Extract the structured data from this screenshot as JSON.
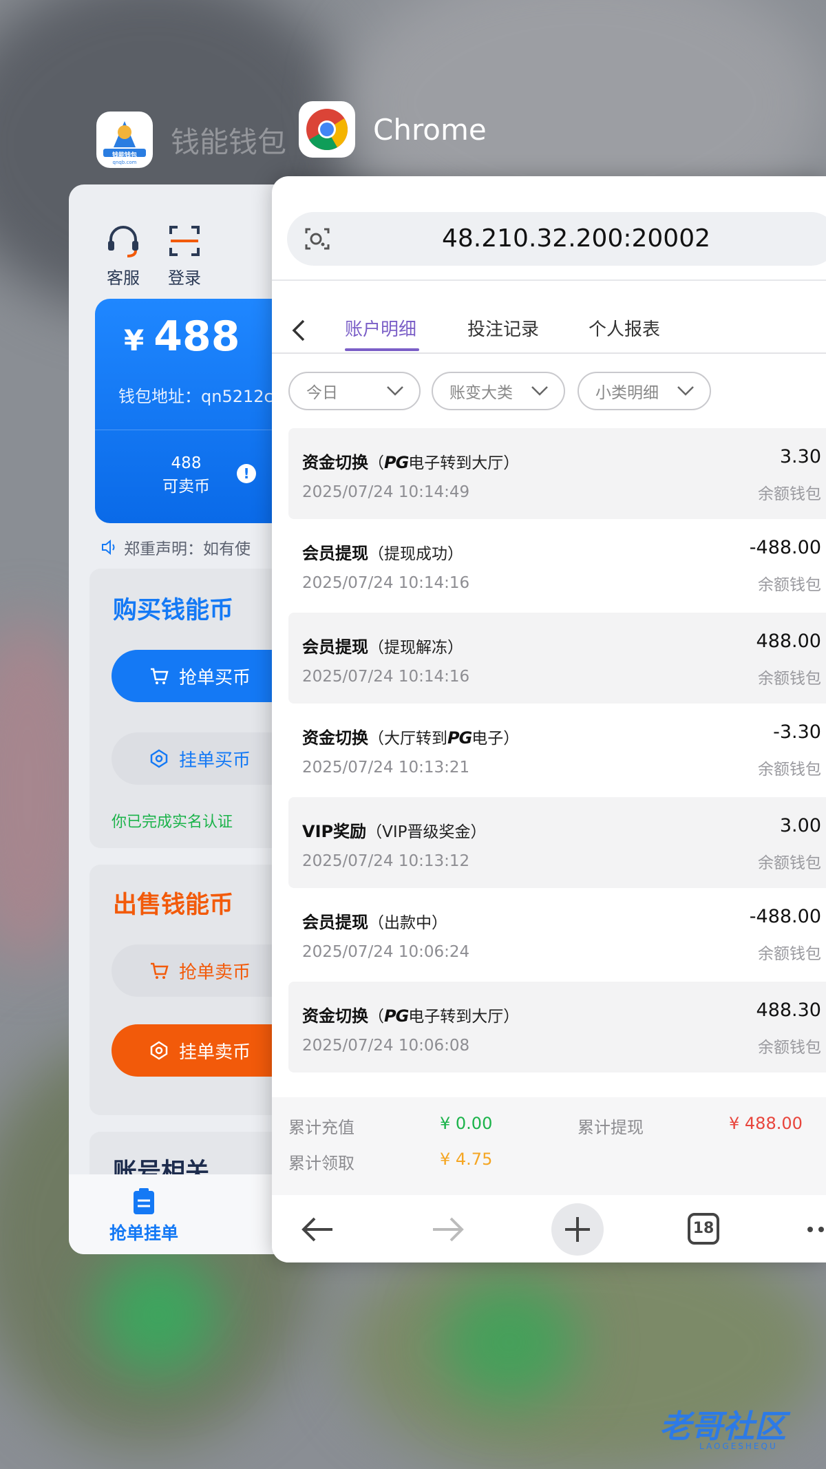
{
  "switcher": {
    "wallet_app_name": "钱能钱包",
    "wallet_icon_text": "钱能钱包",
    "wallet_icon_sub": "qnqb.com",
    "chrome_app_name": "Chrome"
  },
  "wallet": {
    "support_label": "客服",
    "login_label": "登录",
    "currency_symbol": "¥",
    "balance": "488",
    "address_label": "钱包地址：qn5212c",
    "sellable_value": "488",
    "sellable_label": "可卖币",
    "notice": "郑重声明：如有使",
    "buy_title": "购买钱能币",
    "grab_buy_label": "抢单买币",
    "post_buy_label": "挂单买币",
    "verified_text": "你已完成实名认证",
    "sell_title": "出售钱能币",
    "grab_sell_label": "抢单卖币",
    "post_sell_label": "挂单卖币",
    "account_title": "账号相关",
    "tab_orders_label": "抢单挂单"
  },
  "chrome": {
    "url": "48.210.32.200:20002",
    "tabs": [
      "账户明细",
      "投注记录",
      "个人报表"
    ],
    "filters": [
      "今日",
      "账变大类",
      "小类明细"
    ],
    "tab_count": "18"
  },
  "transactions": [
    {
      "title": "资金切换",
      "sub_pre": "（",
      "pg": "PG",
      "sub_post": "电子转到大厅）",
      "time": "2025/07/24 10:14:49",
      "amount": "3.30",
      "wallet": "余额钱包"
    },
    {
      "title": "会员提现",
      "sub_pre": "（提现成功）",
      "pg": "",
      "sub_post": "",
      "time": "2025/07/24 10:14:16",
      "amount": "-488.00",
      "wallet": "余额钱包"
    },
    {
      "title": "会员提现",
      "sub_pre": "（提现解冻）",
      "pg": "",
      "sub_post": "",
      "time": "2025/07/24 10:14:16",
      "amount": "488.00",
      "wallet": "余额钱包"
    },
    {
      "title": "资金切换",
      "sub_pre": "（大厅转到",
      "pg": "PG",
      "sub_post": "电子）",
      "time": "2025/07/24 10:13:21",
      "amount": "-3.30",
      "wallet": "余额钱包"
    },
    {
      "title": "VIP奖励",
      "sub_pre": "（VIP晋级奖金）",
      "pg": "",
      "sub_post": "",
      "time": "2025/07/24 10:13:12",
      "amount": "3.00",
      "wallet": "余额钱包"
    },
    {
      "title": "会员提现",
      "sub_pre": "（出款中）",
      "pg": "",
      "sub_post": "",
      "time": "2025/07/24 10:06:24",
      "amount": "-488.00",
      "wallet": "余额钱包"
    },
    {
      "title": "资金切换",
      "sub_pre": "（",
      "pg": "PG",
      "sub_post": "电子转到大厅）",
      "time": "2025/07/24 10:06:08",
      "amount": "488.30",
      "wallet": "余额钱包"
    }
  ],
  "summary": {
    "deposit_label": "累计充值",
    "deposit_value": "¥ 0.00",
    "withdraw_label": "累计提现",
    "withdraw_value": "¥ 488.00",
    "claim_label": "累计领取",
    "claim_value": "¥ 4.75"
  },
  "watermark": {
    "text": "老哥社区",
    "sub": "LAOGESHEQU"
  },
  "colors": {
    "accent_purple": "#7b5fc7",
    "wallet_blue": "#1479f5",
    "sell_orange": "#f25a0a",
    "positive_green": "#1bb34a",
    "negative_red": "#e8453c",
    "claim_orange": "#f5a623"
  }
}
